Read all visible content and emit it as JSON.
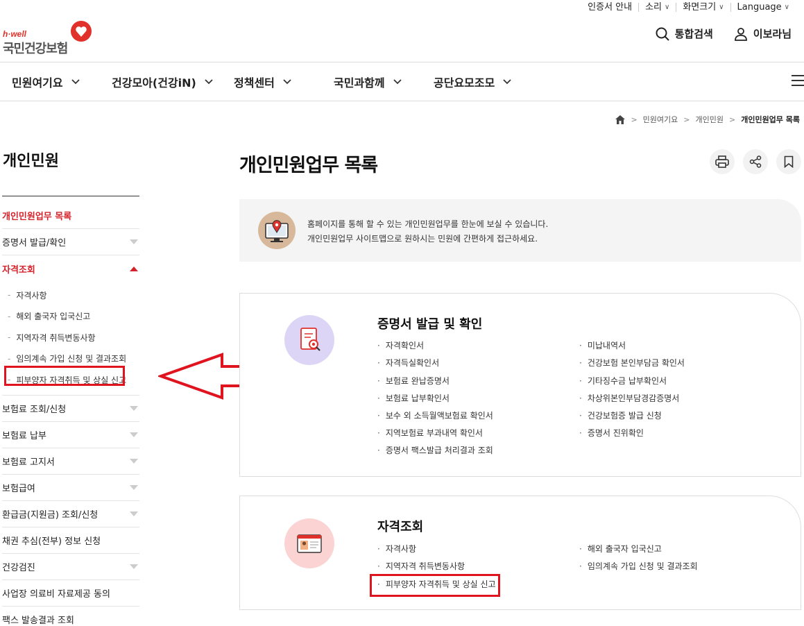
{
  "utility": {
    "cert": "인증서 안내",
    "sound": "소리",
    "fontsize": "화면크기",
    "language": "Language"
  },
  "logo": {
    "tag": "h·well",
    "name": "국민건강보험"
  },
  "header": {
    "search": "통합검색",
    "user": "이보라님"
  },
  "gnb": [
    "민원여기요",
    "건강모아(건강iN)",
    "정책센터",
    "국민과함께",
    "공단요모조모"
  ],
  "breadcrumb": [
    "민원여기요",
    "개인민원",
    "개인민원업무 목록"
  ],
  "side": {
    "title": "개인민원",
    "items": [
      {
        "label": "개인민원업무 목록",
        "active": true,
        "arrow": "none"
      },
      {
        "label": "증명서 발급/확인",
        "active": false,
        "arrow": "down"
      },
      {
        "label": "자격조회",
        "active": true,
        "arrow": "up"
      }
    ],
    "subs": [
      "자격사항",
      "해외 출국자 입국신고",
      "지역자격 취득변동사항",
      "임의계속 가입 신청 및 결과조회",
      "피부양자 자격취득 및 상실 신고"
    ],
    "items2": [
      {
        "label": "보험료 조회/신청",
        "arrow": "down"
      },
      {
        "label": "보험료 납부",
        "arrow": "down"
      },
      {
        "label": "보험료 고지서",
        "arrow": "down"
      },
      {
        "label": "보험급여",
        "arrow": "down"
      },
      {
        "label": "환급금(지원금) 조회/신청",
        "arrow": "down"
      },
      {
        "label": "채권 추심(전부) 정보 신청",
        "arrow": "none"
      },
      {
        "label": "건강검진",
        "arrow": "down"
      },
      {
        "label": "사업장 의료비 자료제공 동의",
        "arrow": "none"
      },
      {
        "label": "팩스 발송결과 조회",
        "arrow": "none"
      }
    ]
  },
  "main": {
    "title": "개인민원업무 목록",
    "intro": [
      "홈페이지를 통해 할 수 있는 개인민원업무를 한눈에 보실 수 있습니다.",
      "개인민원업무 사이트맵으로 원하시는 민원에 간편하게 접근하세요."
    ]
  },
  "cards": [
    {
      "title": "증명서 발급 및 확인",
      "left": [
        "자격확인서",
        "자격득실확인서",
        "보험료 완납증명서",
        "보험료 납부확인서",
        "보수 외 소득월액보험료 확인서",
        "지역보험료 부과내역 확인서",
        "증명서 팩스발급 처리결과 조회"
      ],
      "right": [
        "미납내역서",
        "건강보험 본인부담금 확인서",
        "기타징수금 납부확인서",
        "차상위본인부담경감증명서",
        "건강보험증 발급 신청",
        "증명서 진위확인"
      ]
    },
    {
      "title": "자격조회",
      "left": [
        "자격사항",
        "지역자격 취득변동사항",
        "피부양자 자격취득 및 상실 신고"
      ],
      "right": [
        "해외 출국자 입국신고",
        "임의계속 가입 신청 및 결과조회"
      ]
    }
  ],
  "colors": {
    "accent": "#d3222a",
    "highlight": "#e0141e"
  }
}
